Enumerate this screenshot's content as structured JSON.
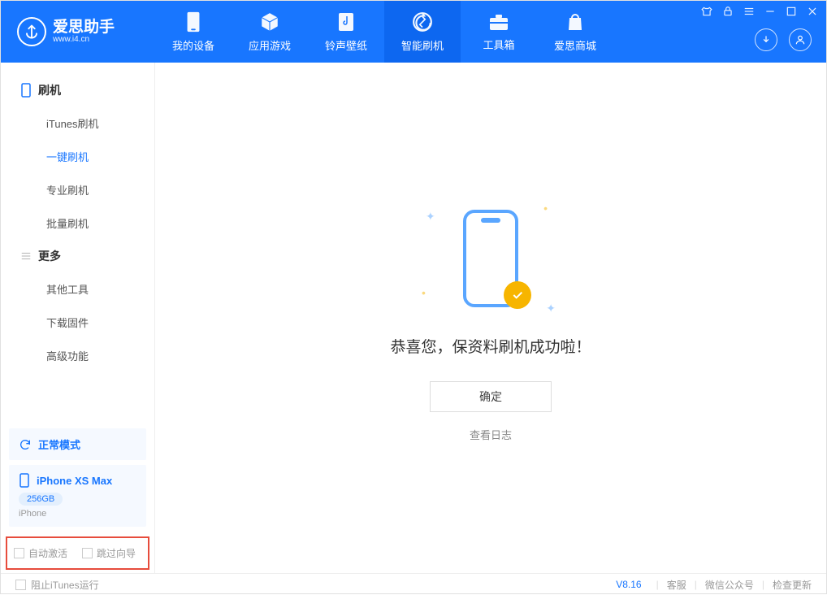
{
  "header": {
    "logo_title": "爱思助手",
    "logo_sub": "www.i4.cn",
    "tabs": [
      {
        "label": "我的设备"
      },
      {
        "label": "应用游戏"
      },
      {
        "label": "铃声壁纸"
      },
      {
        "label": "智能刷机"
      },
      {
        "label": "工具箱"
      },
      {
        "label": "爱思商城"
      }
    ]
  },
  "sidebar": {
    "group1_title": "刷机",
    "group1_items": [
      "iTunes刷机",
      "一键刷机",
      "专业刷机",
      "批量刷机"
    ],
    "group2_title": "更多",
    "group2_items": [
      "其他工具",
      "下载固件",
      "高级功能"
    ],
    "mode_panel": "正常模式",
    "device_name": "iPhone XS Max",
    "device_storage": "256GB",
    "device_type": "iPhone",
    "check_auto_activate": "自动激活",
    "check_skip_guide": "跳过向导"
  },
  "main": {
    "success_text": "恭喜您，保资料刷机成功啦！",
    "confirm": "确定",
    "view_log": "查看日志"
  },
  "footer": {
    "block_itunes": "阻止iTunes运行",
    "version": "V8.16",
    "support": "客服",
    "wechat": "微信公众号",
    "check_update": "检查更新"
  }
}
